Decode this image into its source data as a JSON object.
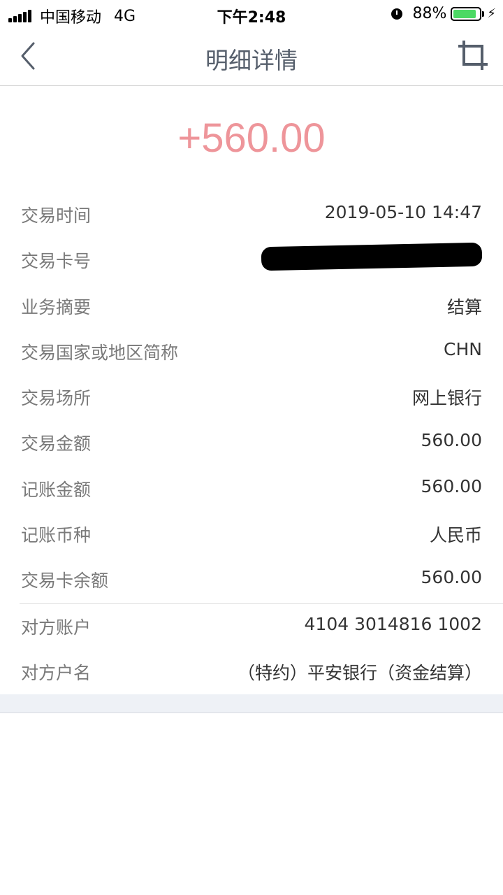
{
  "status_bar": {
    "carrier": "中国移动",
    "network": "4G",
    "time": "下午2:48",
    "battery_percent": "88%",
    "battery_level": 0.88,
    "alarm_icon": "alarm-icon",
    "charging_icon": "bolt-icon"
  },
  "nav": {
    "title": "明细详情",
    "back_icon": "back-chevron-icon",
    "crop_icon": "crop-icon"
  },
  "amount": "+560.00",
  "amount_color": "#ee959a",
  "details": [
    {
      "label": "交易时间",
      "value": "2019-05-10 14:47"
    },
    {
      "label": "交易卡号",
      "value": "",
      "redacted": true
    },
    {
      "label": "业务摘要",
      "value": "结算"
    },
    {
      "label": "交易国家或地区简称",
      "value": "CHN"
    },
    {
      "label": "交易场所",
      "value": "网上银行"
    },
    {
      "label": "交易金额",
      "value": "560.00"
    },
    {
      "label": "记账金额",
      "value": "560.00"
    },
    {
      "label": "记账币种",
      "value": "人民币"
    },
    {
      "label": "交易卡余额",
      "value": "560.00"
    }
  ],
  "counterparty": [
    {
      "label": "对方账户",
      "value": "4104 3014816 1002"
    },
    {
      "label": "对方户名",
      "value": "（特约）平安银行（资金结算）"
    }
  ]
}
